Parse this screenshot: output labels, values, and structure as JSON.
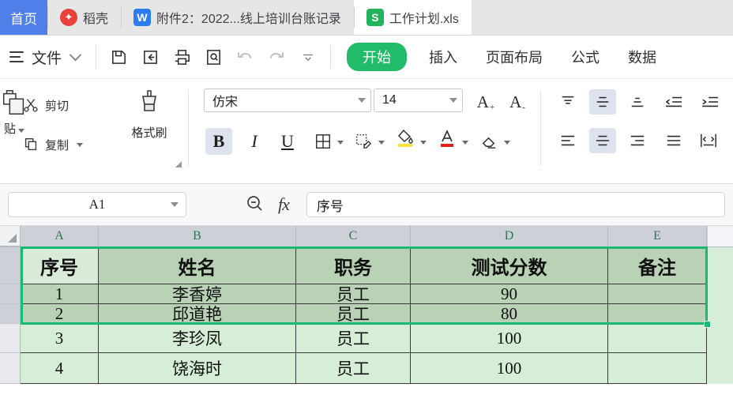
{
  "window": {
    "tabs": [
      {
        "label": "首页",
        "icon": "home-icon",
        "state": "home"
      },
      {
        "label": "稻壳",
        "icon": "docer-icon",
        "state": "inactive"
      },
      {
        "label": "附件2：2022...线上培训台账记录",
        "icon": "word-doc-icon",
        "state": "inactive"
      },
      {
        "label": "工作计划.xls",
        "icon": "spreadsheet-icon",
        "state": "active"
      }
    ]
  },
  "menu": {
    "file_label": "文件",
    "quick_access": [
      {
        "name": "save-icon",
        "title": "保存"
      },
      {
        "name": "save-as-icon",
        "title": "输出"
      },
      {
        "name": "print-icon",
        "title": "打印"
      },
      {
        "name": "print-preview-icon",
        "title": "打印预览"
      },
      {
        "name": "undo-icon",
        "title": "撤销"
      },
      {
        "name": "redo-icon",
        "title": "恢复"
      },
      {
        "name": "more-chevron-icon",
        "title": "更多"
      }
    ],
    "ribbon_tabs": [
      {
        "label": "开始",
        "active": true
      },
      {
        "label": "插入",
        "active": false
      },
      {
        "label": "页面布局",
        "active": false
      },
      {
        "label": "公式",
        "active": false
      },
      {
        "label": "数据",
        "active": false
      }
    ]
  },
  "ribbon": {
    "clipboard": {
      "paste_label": "贴",
      "cut_label": "剪切",
      "copy_label": "复制",
      "format_painter_label": "格式刷"
    },
    "font": {
      "family_value": "仿宋",
      "size_value": "14",
      "grow_label": "A",
      "grow_sup": "+",
      "shrink_label": "A",
      "shrink_sup": "-",
      "bold_label": "B",
      "italic_label": "I",
      "underline_label": "U",
      "bold_active": true,
      "buttons": [
        {
          "name": "bold-button"
        },
        {
          "name": "italic-button"
        },
        {
          "name": "underline-button"
        },
        {
          "name": "borders-button"
        },
        {
          "name": "draw-borders-button"
        },
        {
          "name": "fill-color-button",
          "color": "#f5e03c"
        },
        {
          "name": "font-color-button",
          "color": "#e02020"
        },
        {
          "name": "clear-format-button"
        }
      ]
    },
    "alignment": {
      "top_align": "align-top-button",
      "middle_align": "align-middle-button",
      "bottom_align": "align-bottom-button",
      "decrease_indent": "decrease-indent-button",
      "increase_indent": "increase-indent-button",
      "left_align": "align-left-button",
      "center_align": "align-center-button",
      "right_align": "align-right-button",
      "justify_align": "align-justify-button",
      "wrap_text": "wrap-text-button",
      "middle_active": true,
      "center_active": true
    }
  },
  "formula_bar": {
    "name_box_value": "A1",
    "fx_label": "fx",
    "formula_value": "序号",
    "insert_function_icon": "zoom-function-icon"
  },
  "sheet": {
    "columns": [
      "A",
      "B",
      "C",
      "D",
      "E"
    ],
    "header_row": [
      "序号",
      "姓名",
      "职务",
      "测试分数",
      "备注"
    ],
    "rows": [
      {
        "序号": "1",
        "姓名": "李香婷",
        "职务": "员工",
        "测试分数": "90",
        "备注": ""
      },
      {
        "序号": "2",
        "姓名": "邱道艳",
        "职务": "员工",
        "测试分数": "80",
        "备注": ""
      },
      {
        "序号": "3",
        "姓名": "李珍凤",
        "职务": "员工",
        "测试分数": "100",
        "备注": ""
      },
      {
        "序号": "4",
        "姓名": "饶海时",
        "职务": "员工",
        "测试分数": "100",
        "备注": ""
      }
    ],
    "selection_range": "A1:E3",
    "colors": {
      "selection_border": "#19b971",
      "selected_fill": "#b9d2b6",
      "unselected_fill": "#d6eed8",
      "active_cell_fill": "#d9ead9",
      "column_header": "#cdd0d6"
    }
  }
}
